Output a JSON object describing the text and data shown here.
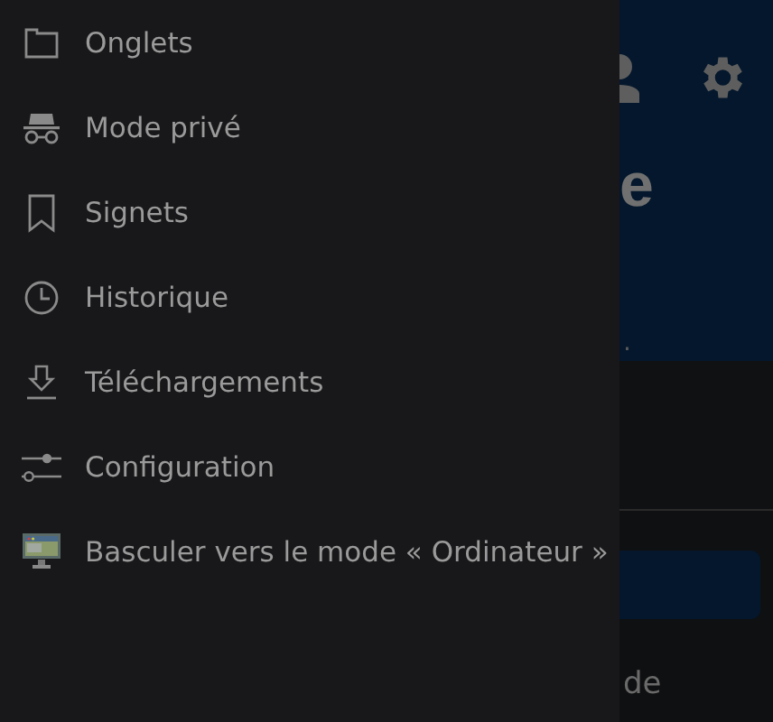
{
  "drawer": {
    "items": [
      {
        "label": "Onglets"
      },
      {
        "label": "Mode privé"
      },
      {
        "label": "Signets"
      },
      {
        "label": "Historique"
      },
      {
        "label": "Téléchargements"
      },
      {
        "label": "Configuration"
      },
      {
        "label": "Basculer vers le mode « Ordinateur »"
      }
    ]
  },
  "background": {
    "heading": "e",
    "subtitle": ".",
    "link": "de"
  }
}
